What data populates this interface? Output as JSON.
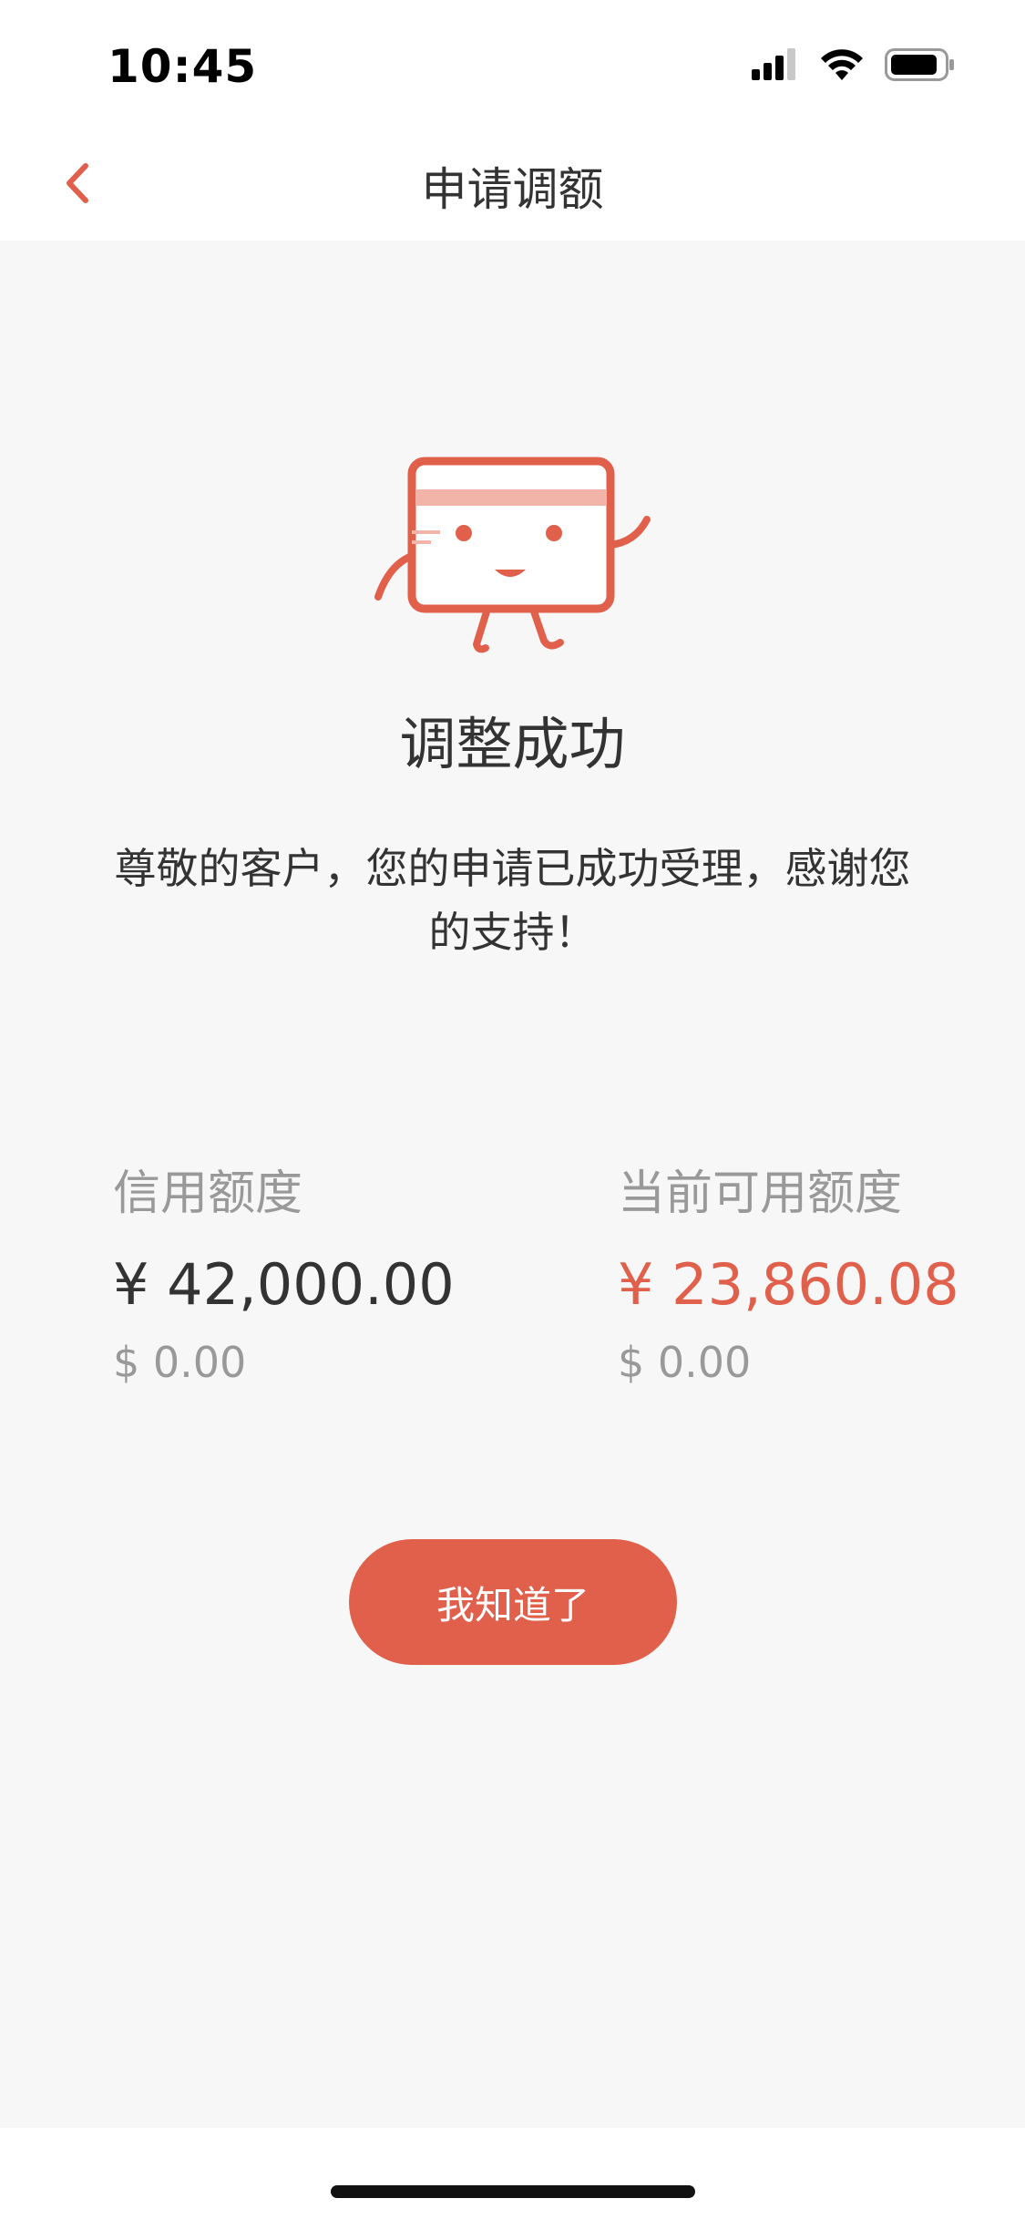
{
  "status_bar": {
    "time": "10:45"
  },
  "nav": {
    "title": "申请调额"
  },
  "result": {
    "title": "调整成功",
    "description": "尊敬的客户，您的申请已成功受理，感谢您的支持！"
  },
  "limits": {
    "credit": {
      "label": "信用额度",
      "cny": "¥ 42,000.00",
      "usd": "$ 0.00"
    },
    "available": {
      "label": "当前可用额度",
      "cny": "¥ 23,860.08",
      "usd": "$ 0.00"
    }
  },
  "actions": {
    "confirm_label": "我知道了"
  },
  "colors": {
    "accent": "#e0604c",
    "muted_text": "#999999",
    "primary_text": "#333333",
    "background": "#f7f7f7"
  },
  "icons": [
    "chevron-left-icon",
    "card-mascot-icon",
    "signal-icon",
    "wifi-icon",
    "battery-icon"
  ]
}
